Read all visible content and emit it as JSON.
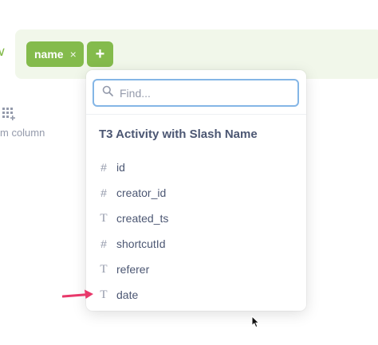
{
  "filter_bar": {
    "active_column_pill": "name",
    "remove_glyph": "×",
    "add_glyph": "+",
    "left_glyph": "∨"
  },
  "sidebar": {
    "custom_column_label": "m column"
  },
  "column_picker": {
    "search_placeholder": "Find...",
    "table_name": "T3 Activity with Slash Name",
    "columns": [
      {
        "type_icon": "#",
        "icon_name": "number-icon",
        "label": "id"
      },
      {
        "type_icon": "#",
        "icon_name": "number-icon",
        "label": "creator_id"
      },
      {
        "type_icon": "T",
        "icon_name": "text-icon",
        "label": "created_ts"
      },
      {
        "type_icon": "#",
        "icon_name": "number-icon",
        "label": "shortcutId"
      },
      {
        "type_icon": "T",
        "icon_name": "text-icon",
        "label": "referer"
      },
      {
        "type_icon": "T",
        "icon_name": "text-icon",
        "label": "date"
      }
    ]
  },
  "colors": {
    "accent_green": "#84bb4c",
    "bar_background": "#f1f7ea",
    "search_border": "#84b6e6",
    "annotation_arrow": "#e8386a"
  }
}
